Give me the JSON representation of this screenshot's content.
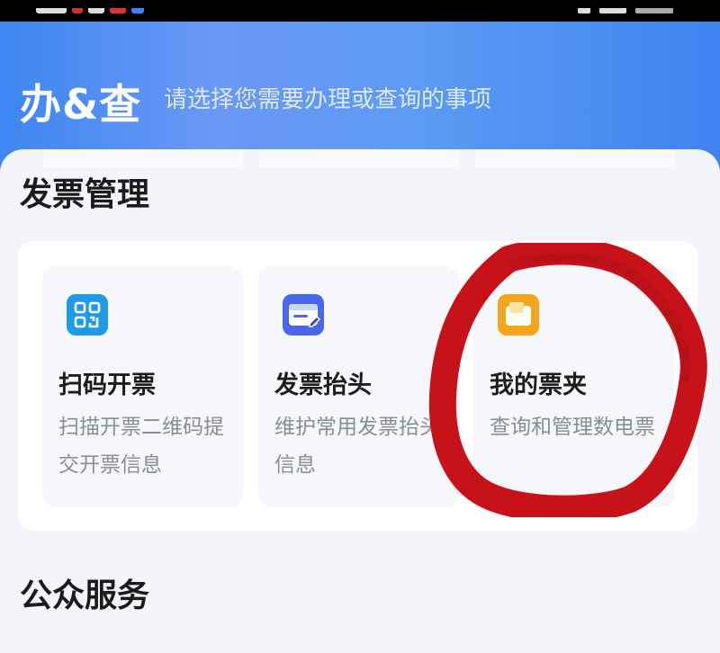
{
  "header": {
    "title": "办&查",
    "subtitle": "请选择您需要办理或查询的事项"
  },
  "invoice_section": {
    "title": "发票管理",
    "items": [
      {
        "label": "扫码开票",
        "desc": "扫描开票二维码提交开票信息",
        "icon": "qr-scan-icon",
        "icon_color": "#1f9be6"
      },
      {
        "label": "发票抬头",
        "desc": "维护常用发票抬头信息",
        "icon": "invoice-header-icon",
        "icon_color": "#4a66ea"
      },
      {
        "label": "我的票夹",
        "desc": "查询和管理数电票",
        "icon": "folder-icon",
        "icon_color": "#f4a519"
      }
    ]
  },
  "public_section": {
    "title": "公众服务"
  },
  "annotation": {
    "color": "#c8121a",
    "shape": "hand-drawn-circle",
    "target": "我的票夹"
  }
}
